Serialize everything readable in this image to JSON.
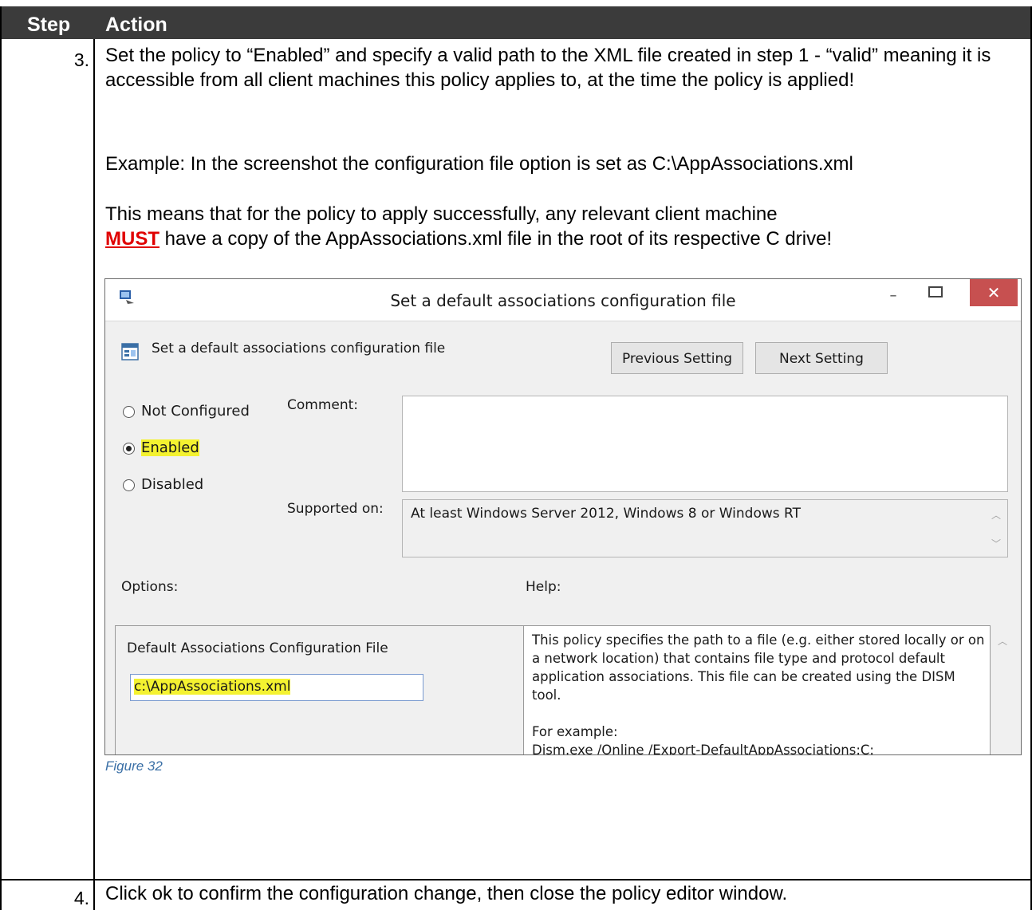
{
  "header": {
    "step_col": "Step",
    "action_col": "Action"
  },
  "steps": [
    {
      "number": "3.",
      "paragraphs": [
        "Set the policy to “Enabled” and specify a valid path to the XML file created in step 1 - “valid” meaning it is accessible from all client machines this policy applies to, at the time the policy is applied!",
        "Example: In the screenshot the configuration file option is set as C:\\AppAssociations.xml"
      ],
      "must_word": "MUST",
      "p3_before": "This means that for the policy to apply successfully, any relevant client machine",
      "p3_after": " have a copy of the AppAssociations.xml file in the root of its respective C drive!",
      "figure_caption": "Figure 32"
    },
    {
      "number": "4.",
      "text": "Click ok to confirm the configuration change, then close the policy editor window."
    }
  ],
  "dialog": {
    "window_title": "Set a default associations configuration file",
    "policy_name": "Set a default associations configuration file",
    "previous_button": "Previous Setting",
    "next_button": "Next Setting",
    "radios": [
      {
        "label": "Not Configured",
        "checked": false
      },
      {
        "label": "Enabled",
        "checked": true
      },
      {
        "label": "Disabled",
        "checked": false
      }
    ],
    "comment_label": "Comment:",
    "comment_value": "",
    "supported_label": "Supported on:",
    "supported_value": "At least Windows Server 2012, Windows 8 or Windows RT",
    "options_label": "Options:",
    "help_label": "Help:",
    "option_field_label": "Default Associations Configuration File",
    "option_field_value": "c:\\AppAssociations.xml",
    "help_text": "This policy specifies the path to a file (e.g. either stored locally or on a network location) that contains file type and protocol default application associations. This file can be created using the DISM tool.",
    "help_example_label": "For example:",
    "help_example_cmd": "Dism.exe /Online /Export-DefaultAppAssociations:C:"
  }
}
